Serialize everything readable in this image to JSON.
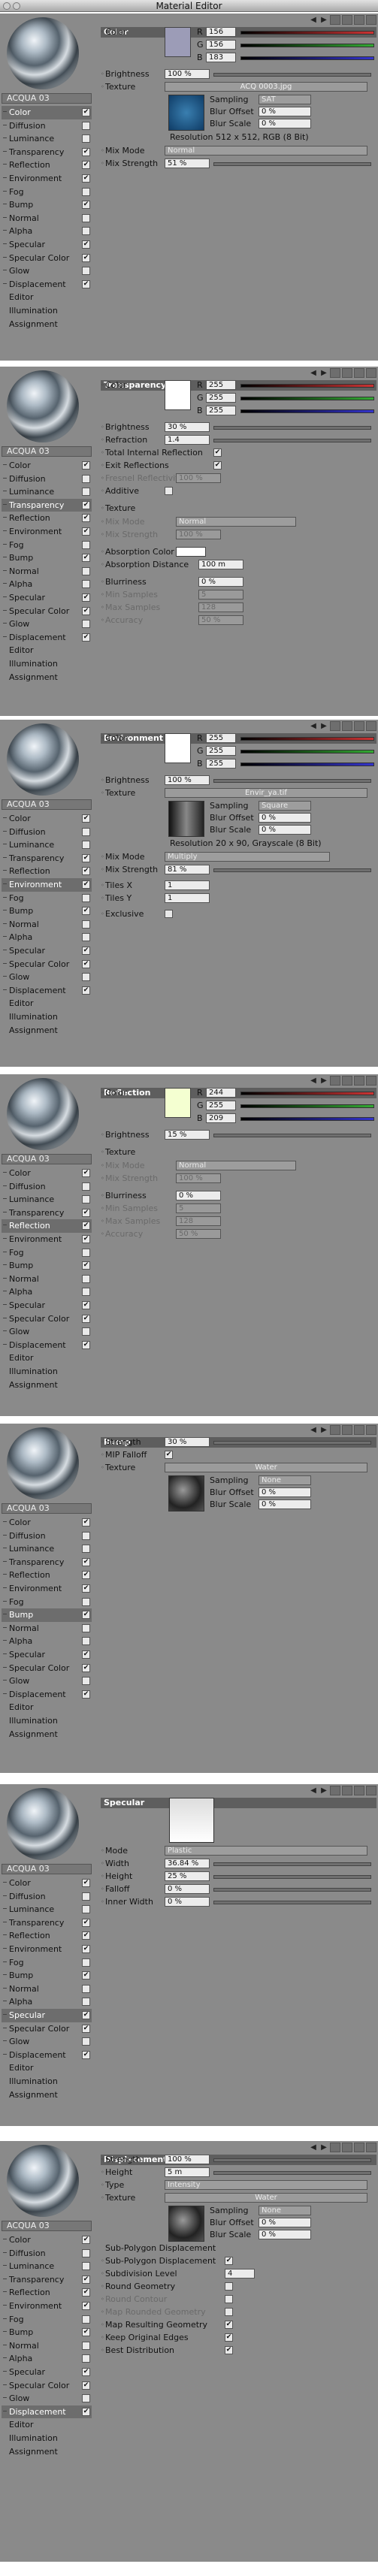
{
  "window": {
    "title": "Material Editor"
  },
  "material": {
    "name": "ACQUA 03"
  },
  "channels": [
    "Color",
    "Diffusion",
    "Luminance",
    "Transparency",
    "Reflection",
    "Environment",
    "Fog",
    "Bump",
    "Normal",
    "Alpha",
    "Specular",
    "Specular Color",
    "Glow",
    "Displacement",
    "Editor",
    "Illumination",
    "Assignment"
  ],
  "labels": {
    "color": "Color",
    "r": "R",
    "g": "G",
    "b": "B",
    "brightness": "Brightness",
    "texture": "Texture",
    "sampling": "Sampling",
    "blur_offset": "Blur Offset",
    "blur_scale": "Blur Scale",
    "mix_mode": "Mix Mode",
    "mix_strength": "Mix Strength",
    "refraction": "Refraction",
    "total_internal": "Total Internal Reflection",
    "exit_reflections": "Exit Reflections",
    "fresnel": "Fresnel Reflectivity",
    "additive": "Additive",
    "absorption_color": "Absorption Color",
    "absorption_distance": "Absorption Distance",
    "blurriness": "Blurriness",
    "min_samples": "Min Samples",
    "max_samples": "Max Samples",
    "accuracy": "Accuracy",
    "tiles_x": "Tiles X",
    "tiles_y": "Tiles Y",
    "exclusive": "Exclusive",
    "strength": "Strength",
    "mip_falloff": "MIP Falloff",
    "mode": "Mode",
    "width": "Width",
    "height": "Height",
    "falloff": "Falloff",
    "inner_width": "Inner Width",
    "type": "Type",
    "subpoly_group": "Sub-Polygon Displacement",
    "subpoly": "Sub-Polygon Displacement",
    "subdiv_level": "Subdivision Level",
    "round_geometry": "Round Geometry",
    "round_contour": "Round Contour",
    "map_rounded": "Map Rounded Geometry",
    "map_resulting": "Map Resulting Geometry",
    "keep_original": "Keep Original Edges",
    "best_distribution": "Best Distribution"
  },
  "panels": [
    {
      "id": "color",
      "title": "Color",
      "selected": "Color",
      "rgb": [
        "156",
        "156",
        "183"
      ],
      "brightness": "100 %",
      "texture": "ACQ 0003.jpg",
      "sampling": "SAT",
      "blur_offset": "0 %",
      "blur_scale": "0 %",
      "resolution": "Resolution 512 x 512, RGB (8 Bit)",
      "mix_mode": "Normal",
      "mix_strength": "51 %"
    },
    {
      "id": "transparency",
      "title": "Transparency",
      "selected": "Transparency",
      "rgb": [
        "255",
        "255",
        "255"
      ],
      "brightness": "30 %",
      "refraction": "1.4",
      "fresnel": "100 %",
      "mix_mode": "Normal",
      "mix_strength": "100 %",
      "absorption_distance": "100 m",
      "blurriness": "0 %",
      "min_samples": "5",
      "max_samples": "128",
      "accuracy": "50 %"
    },
    {
      "id": "environment",
      "title": "Environment",
      "selected": "Environment",
      "rgb": [
        "255",
        "255",
        "255"
      ],
      "brightness": "100 %",
      "texture": "Envir_ya.tif",
      "sampling": "Square",
      "blur_offset": "0 %",
      "blur_scale": "0 %",
      "resolution": "Resolution 20 x 90, Grayscale (8 Bit)",
      "mix_mode": "Multiply",
      "mix_strength": "81 %",
      "tiles_x": "1",
      "tiles_y": "1"
    },
    {
      "id": "reflection",
      "title": "Reflection",
      "selected": "Reflection",
      "rgb": [
        "244",
        "255",
        "209"
      ],
      "brightness": "15 %",
      "mix_mode": "Normal",
      "mix_strength": "100 %",
      "blurriness": "0 %",
      "min_samples": "5",
      "max_samples": "128",
      "accuracy": "50 %"
    },
    {
      "id": "bump",
      "title": "Bump",
      "selected": "Bump",
      "strength": "30 %",
      "texture": "Water",
      "sampling": "None",
      "blur_offset": "0 %",
      "blur_scale": "0 %"
    },
    {
      "id": "specular",
      "title": "Specular",
      "selected": "Specular",
      "mode": "Plastic",
      "width": "36.84 %",
      "height": "25 %",
      "falloff": "0 %",
      "inner_width": "0 %"
    },
    {
      "id": "displacement",
      "title": "Displacement",
      "selected": "Displacement",
      "strength": "100 %",
      "height": "5 m",
      "type": "Intensity",
      "texture": "Water",
      "sampling": "None",
      "blur_offset": "0 %",
      "blur_scale": "0 %",
      "subdiv_level": "4"
    }
  ]
}
